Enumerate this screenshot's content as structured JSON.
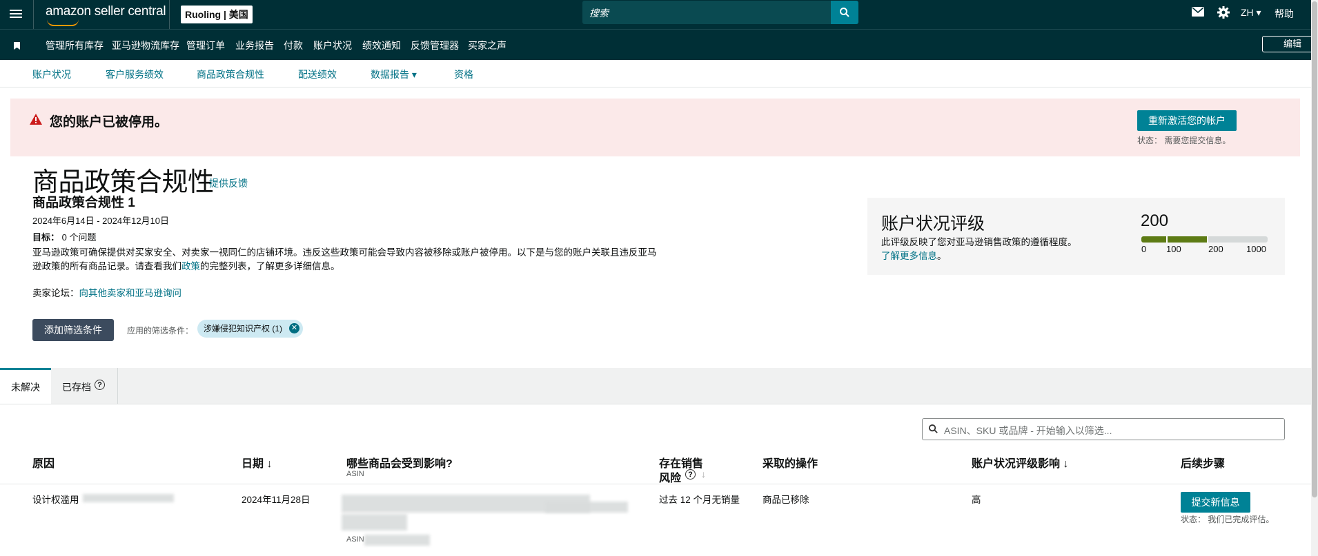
{
  "header": {
    "logo_text": "amazon seller central",
    "store_label": "Ruoling | 美国",
    "search_placeholder": "搜索",
    "lang": "ZH ▾",
    "help": "帮助"
  },
  "nav": {
    "items": [
      "管理所有库存",
      "亚马逊物流库存",
      "管理订单",
      "业务报告",
      "付款",
      "账户状况",
      "绩效通知",
      "反馈管理器",
      "买家之声"
    ],
    "edit": "编辑"
  },
  "subnav": {
    "items": [
      "账户状况",
      "客户服务绩效",
      "商品政策合规性",
      "配送绩效",
      "数据报告 ▾",
      "资格"
    ]
  },
  "alert": {
    "message": "您的账户已被停用。",
    "button": "重新激活您的帐户",
    "status": "状态：  需要您提交信息。"
  },
  "page": {
    "title": "商品政策合规性",
    "feedback": "提供反馈",
    "subtitle": "商品政策合规性 1",
    "dates": "2024年6月14日 - 2024年12月10日",
    "target_label": "目标：",
    "target_value": "0 个问题",
    "desc_1": "亚马逊政策可确保提供对买家安全、对卖家一视同仁的店铺环境。违反这些政策可能会导致内容被移除或账户被停用。以下是与您的账户关联且违反亚马逊政策的所有商品记录。请查看我们",
    "desc_link": "政策",
    "desc_2": "的完整列表，了解更多详细信息。",
    "forum_label": "卖家论坛：",
    "forum_link": "向其他卖家和亚马逊询问",
    "add_filter": "添加筛选条件",
    "applied_label": "应用的筛选条件：",
    "chip": "涉嫌侵犯知识产权 (1)"
  },
  "health_card": {
    "title": "账户状况评级",
    "desc": "此评级反映了您对亚马逊销售政策的遵循程度。",
    "link": "了解更多信息",
    "desc_end": "。",
    "score": "200",
    "score_value": 200,
    "ticks": [
      "0",
      "100",
      "200",
      "1000"
    ]
  },
  "tabs": {
    "unresolved": "未解决",
    "archived": "已存档"
  },
  "table": {
    "filter_placeholder": "ASIN、SKU 或品牌 - 开始输入以筛选...",
    "headers": {
      "reason": "原因",
      "date": "日期 ↓",
      "affected": "哪些商品会受到影响?",
      "affected_sub": "ASIN",
      "risk_1": "存在销售",
      "risk_2": "风险",
      "action": "采取的操作",
      "impact": "账户状况评级影响 ↓",
      "next": "后续步骤"
    },
    "rows": [
      {
        "reason": "设计权滥用",
        "date": "2024年11月28日",
        "asin_label": "ASIN",
        "risk": "过去 12 个月无销量",
        "action": "商品已移除",
        "impact": "高",
        "button": "提交新信息",
        "status": "状态：  我们已完成评估。"
      }
    ]
  }
}
